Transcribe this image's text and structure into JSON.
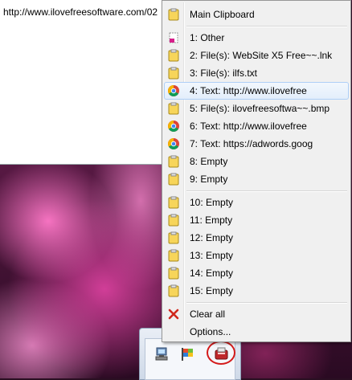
{
  "background_window": {
    "url": "http://www.ilovefreesoftware.com/02"
  },
  "menu": {
    "header": {
      "label": "Main Clipboard",
      "icon": "clipboard-icon"
    },
    "items_group1": [
      {
        "label": "1: Other",
        "icon": "file-icon"
      },
      {
        "label": "2: File(s): WebSite X5 Free~~.lnk",
        "icon": "clipboard-icon"
      },
      {
        "label": "3: File(s): ilfs.txt",
        "icon": "clipboard-icon"
      },
      {
        "label": "4: Text: http://www.ilovefree",
        "icon": "chrome-icon",
        "highlighted": true
      },
      {
        "label": "5: File(s): ilovefreesoftwa~~.bmp",
        "icon": "clipboard-icon"
      },
      {
        "label": "6: Text: http://www.ilovefree",
        "icon": "chrome-icon"
      },
      {
        "label": "7: Text: https://adwords.goog",
        "icon": "chrome-icon"
      },
      {
        "label": "8: Empty",
        "icon": "clipboard-icon"
      },
      {
        "label": "9: Empty",
        "icon": "clipboard-icon"
      }
    ],
    "items_group2": [
      {
        "label": "10: Empty",
        "icon": "clipboard-icon"
      },
      {
        "label": "11: Empty",
        "icon": "clipboard-icon"
      },
      {
        "label": "12: Empty",
        "icon": "clipboard-icon"
      },
      {
        "label": "13: Empty",
        "icon": "clipboard-icon"
      },
      {
        "label": "14: Empty",
        "icon": "clipboard-icon"
      },
      {
        "label": "15: Empty",
        "icon": "clipboard-icon"
      }
    ],
    "clear_all": {
      "label": "Clear all",
      "icon": "red-x-icon"
    },
    "options": {
      "label": "Options..."
    }
  },
  "tray": {
    "icons": [
      "network-icon",
      "flag-icon",
      "clipboard-app-icon"
    ],
    "highlight_color": "#d41b1b"
  },
  "colors": {
    "menu_bg": "#f0f0f0",
    "hover_border": "#aecff7",
    "clipboard_yellow": "#f7d55a"
  }
}
